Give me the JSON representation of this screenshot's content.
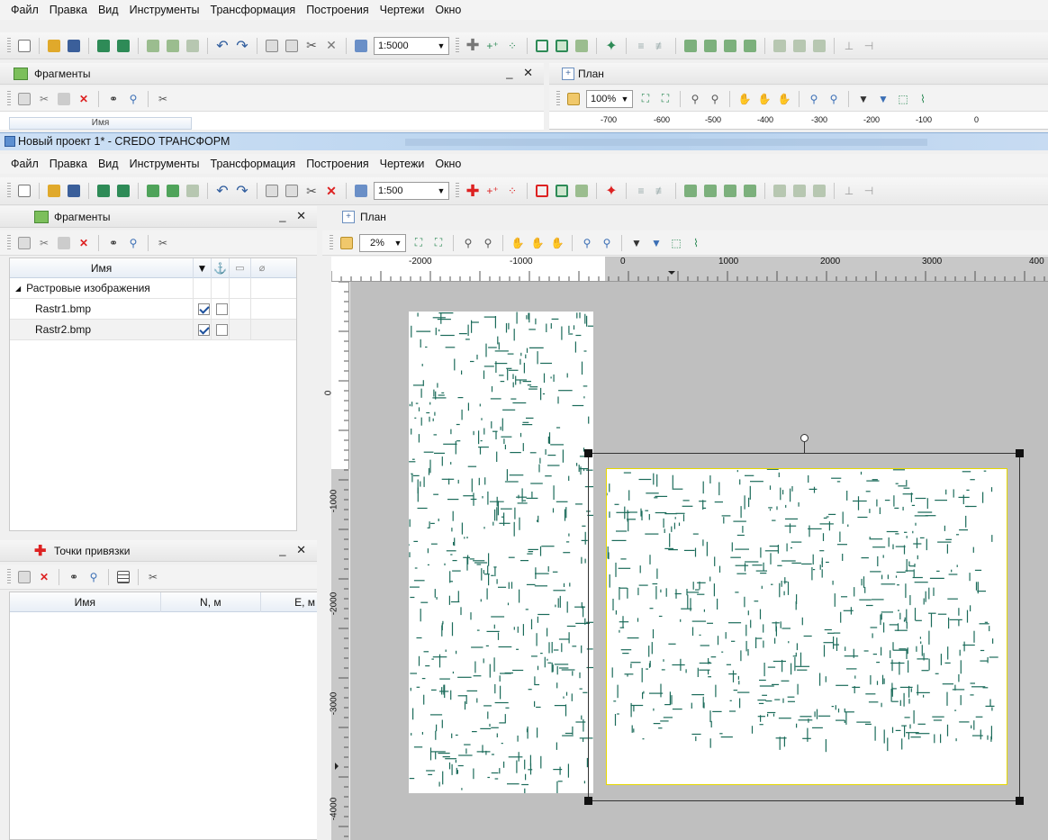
{
  "menu": [
    "Файл",
    "Правка",
    "Вид",
    "Инструменты",
    "Трансформация",
    "Построения",
    "Чертежи",
    "Окно"
  ],
  "back_window": {
    "scale": "1:5000",
    "fragments_title": "Фрагменты",
    "plan_tab": "План",
    "zoom": "100%",
    "col_name": "Имя",
    "ruler_ticks": [
      "-700",
      "-600",
      "-500",
      "-400",
      "-300",
      "-200",
      "-100",
      "0"
    ]
  },
  "window": {
    "title": "Новый проект 1* - CREDO ТРАНСФОРМ",
    "scale": "1:500",
    "plan_tab": "План",
    "zoom": "2%"
  },
  "fragments": {
    "title": "Фрагменты",
    "columns": {
      "name": "Имя"
    },
    "group": "Растровые изображения",
    "items": [
      {
        "name": "Rastr1.bmp",
        "visible": true,
        "anchored": false
      },
      {
        "name": "Rastr2.bmp",
        "visible": true,
        "anchored": false
      }
    ]
  },
  "anchors": {
    "title": "Точки привязки",
    "columns": [
      "Имя",
      "N, м",
      "E, м"
    ]
  },
  "ruler": {
    "h_ticks": [
      "-2000",
      "-1000",
      "0",
      "1000",
      "2000",
      "3000",
      "400"
    ],
    "v_ticks": [
      "0",
      "-1000",
      "-2000",
      "-3000",
      "-4000"
    ]
  },
  "colors": {
    "accent": "#1c4f9c",
    "raster_lines": "#1b6b5a",
    "selection": "#e6d800"
  }
}
